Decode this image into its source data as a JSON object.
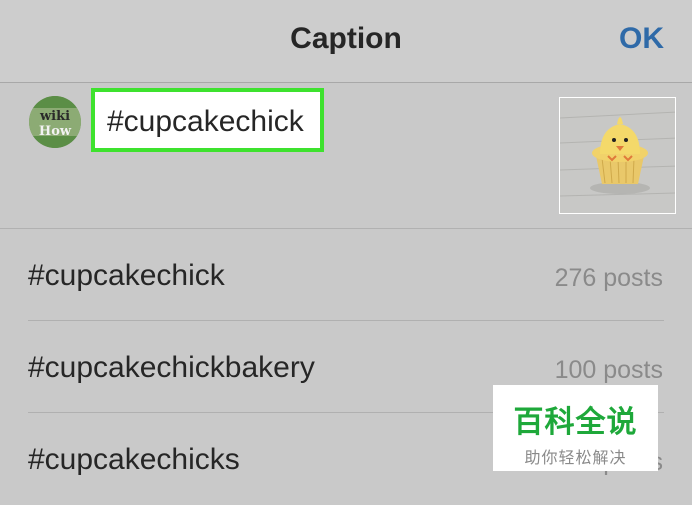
{
  "header": {
    "title": "Caption",
    "ok_label": "OK"
  },
  "compose": {
    "caption_value": "#cupcakechick",
    "avatar_logo_text": [
      "wiki",
      "How"
    ],
    "highlight_color": "#3ee22e"
  },
  "suggestions": [
    {
      "tag": "#cupcakechick",
      "count": "276 posts"
    },
    {
      "tag": "#cupcakechickbakery",
      "count": "100 posts"
    },
    {
      "tag": "#cupcakechicks",
      "count": "55 posts"
    }
  ],
  "watermark": {
    "title": "百科全说",
    "subtitle": "助你轻松解决"
  },
  "colors": {
    "ok_blue": "#2f6aa8",
    "background": "#c9c9c9",
    "watermark_green": "#1ea83a"
  }
}
